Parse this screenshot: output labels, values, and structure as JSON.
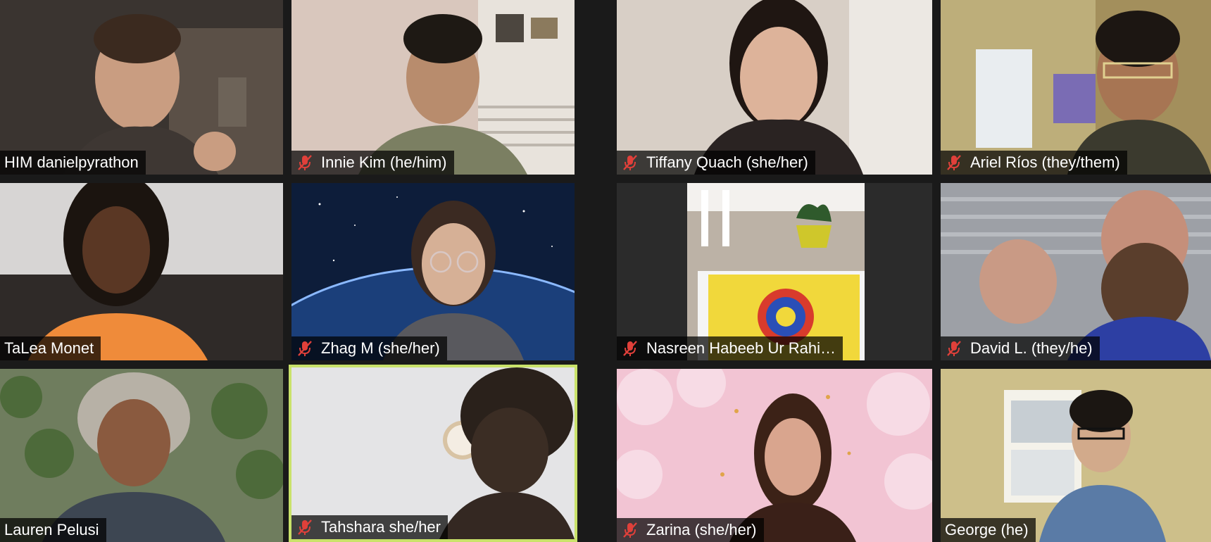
{
  "participants": [
    {
      "name": "HIM danielpyrathon",
      "muted": false,
      "bg": "#3a3430",
      "active": false
    },
    {
      "name": "Innie Kim (he/him)",
      "muted": true,
      "bg": "#d9c7bd",
      "active": false
    },
    {
      "name": "Tiffany Quach (she/her)",
      "muted": true,
      "bg": "#d8cfc6",
      "active": false
    },
    {
      "name": "Ariel Ríos (they/them)",
      "muted": true,
      "bg": "#bdae7a",
      "active": false
    },
    {
      "name": "TaLea Monet",
      "muted": false,
      "bg": "#d7d5d4",
      "active": false
    },
    {
      "name": "Zhag M (she/her)",
      "muted": true,
      "bg": "#0d1d3a",
      "active": false
    },
    {
      "name": "Nasreen Habeeb Ur Rahi…",
      "muted": true,
      "bg": "#2b2b2b",
      "active": false
    },
    {
      "name": "David L. (they/he)",
      "muted": true,
      "bg": "#9da0a6",
      "active": false
    },
    {
      "name": "Lauren Pelusi",
      "muted": false,
      "bg": "#6f7d5e",
      "active": false
    },
    {
      "name": "Tahshara she/her",
      "muted": true,
      "bg": "#e4e4e6",
      "active": true
    },
    {
      "name": "Zarina (she/her)",
      "muted": true,
      "bg": "#f2c4d3",
      "active": false
    },
    {
      "name": "George (he)",
      "muted": false,
      "bg": "#cdbf8a",
      "active": false
    }
  ],
  "colors": {
    "active_border": "#c9e26a",
    "muted_icon": "#e0403a",
    "nameplate_bg": "#000000",
    "tile_gap": "#1a1a1a"
  },
  "icons": {
    "muted": "muted-microphone-icon"
  }
}
